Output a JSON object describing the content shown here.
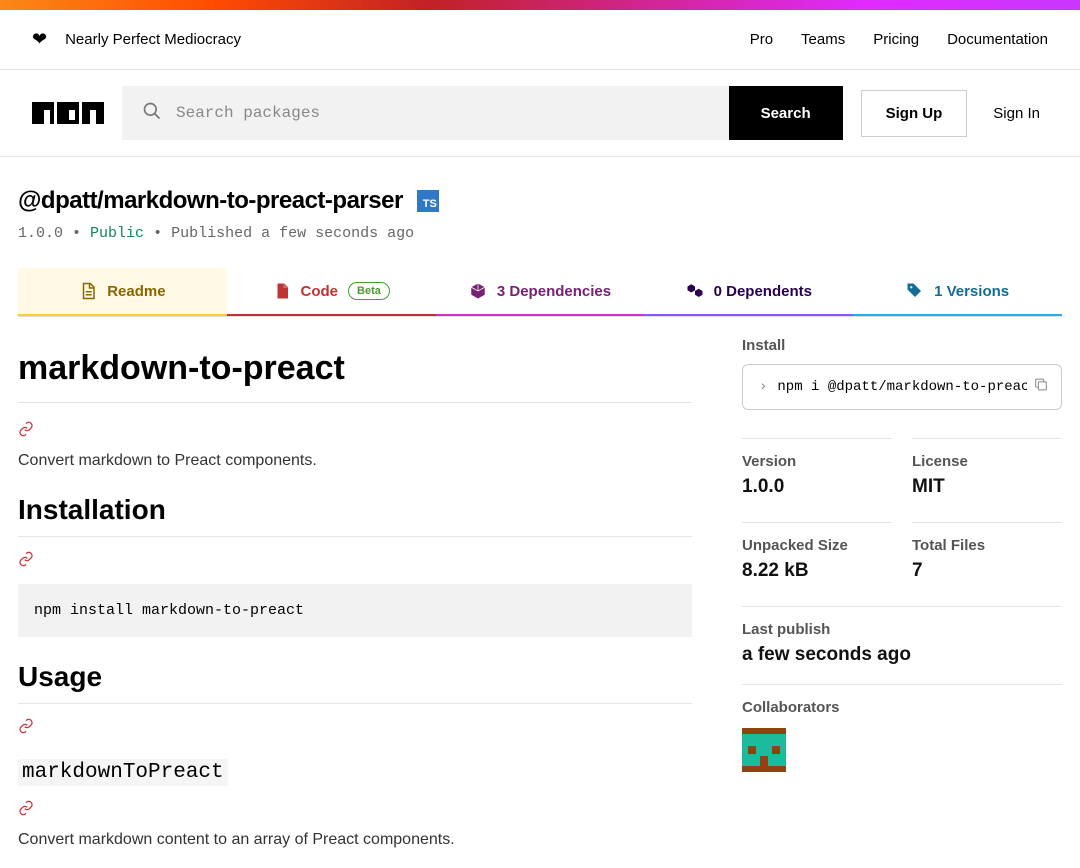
{
  "tagline": "Nearly Perfect Mediocracy",
  "topnav": {
    "pro": "Pro",
    "teams": "Teams",
    "pricing": "Pricing",
    "docs": "Documentation"
  },
  "search": {
    "placeholder": "Search packages",
    "button": "Search"
  },
  "auth": {
    "signup": "Sign Up",
    "signin": "Sign In"
  },
  "package": {
    "name": "@dpatt/markdown-to-preact-parser",
    "ts_badge": "TS",
    "version": "1.0.0",
    "visibility": "Public",
    "published": "Published a few seconds ago"
  },
  "tabs": {
    "readme": "Readme",
    "code": "Code",
    "code_badge": "Beta",
    "deps": "3 Dependencies",
    "dependents": "0 Dependents",
    "versions": "1 Versions"
  },
  "readme": {
    "title": "markdown-to-preact",
    "desc": "Convert markdown to Preact components.",
    "h2_install": "Installation",
    "install_cmd": "npm install markdown-to-preact",
    "h2_usage": "Usage",
    "h3_fn": "markdownToPreact",
    "usage_desc": "Convert markdown content to an array of Preact components."
  },
  "sidebar": {
    "install_label": "Install",
    "install_cmd": "npm i @dpatt/markdown-to-preact-parser",
    "version_label": "Version",
    "version_value": "1.0.0",
    "license_label": "License",
    "license_value": "MIT",
    "unpacked_label": "Unpacked Size",
    "unpacked_value": "8.22 kB",
    "files_label": "Total Files",
    "files_value": "7",
    "last_publish_label": "Last publish",
    "last_publish_value": "a few seconds ago",
    "collab_label": "Collaborators"
  }
}
